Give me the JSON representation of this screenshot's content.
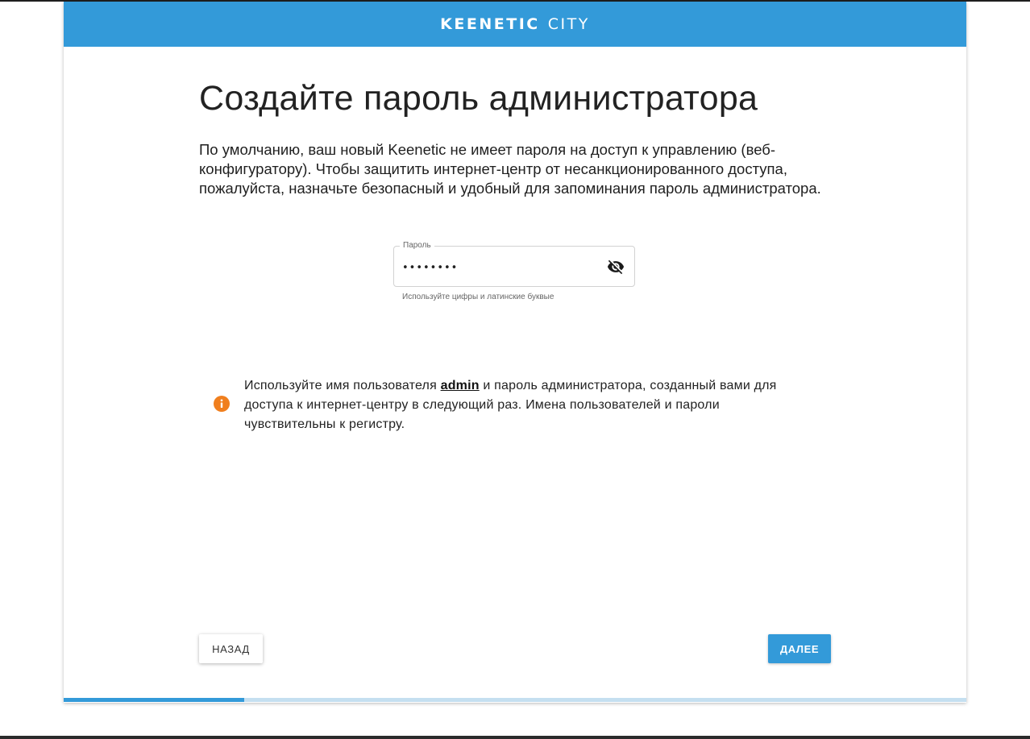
{
  "header": {
    "brand_main": "KEENETIC",
    "brand_sub": "CITY"
  },
  "page": {
    "title": "Создайте пароль администратора",
    "description": "По умолчанию, ваш новый Keenetic не имеет пароля на доступ к управлению (веб-конфигуратору). Чтобы защитить интернет-центр от несанкционированного доступа, пожалуйста, назначьте безопасный и удобный для запоминания пароль администратора."
  },
  "password_field": {
    "label": "Пароль",
    "value": "••••••••",
    "hint": "Используйте цифры и латинские буквые",
    "toggle_icon": "eye-off-icon"
  },
  "info": {
    "icon": "info-icon",
    "text_before": "Используйте имя пользователя ",
    "username": "admin",
    "text_after": " и пароль администратора, созданный вами для доступа к интернет-центру в следующий раз. Имена пользователей и пароли чувствительны к регистру."
  },
  "buttons": {
    "back_label": "НАЗАД",
    "next_label": "ДАЛЕЕ"
  },
  "progress": {
    "fraction": 0.2
  },
  "colors": {
    "accent": "#339ad9",
    "info_icon": "#f07f1e",
    "progress_track": "#c5dff0"
  }
}
